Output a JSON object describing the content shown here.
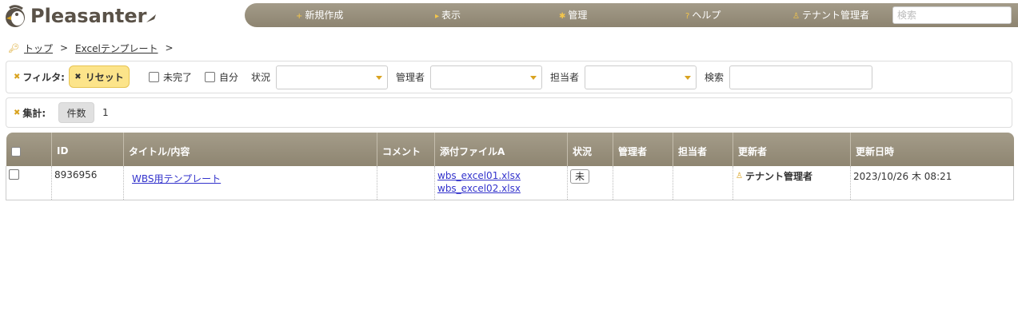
{
  "header": {
    "logo_text": "Pleasanter",
    "nav": [
      {
        "icon": "plus-icon",
        "glyph": "+",
        "label": "新規作成"
      },
      {
        "icon": "triangle-right-icon",
        "glyph": "▸",
        "label": "表示"
      },
      {
        "icon": "gear-icon",
        "glyph": "✱",
        "label": "管理"
      },
      {
        "icon": "question-icon",
        "glyph": "?",
        "label": "ヘルプ"
      },
      {
        "icon": "person-icon",
        "glyph": "♙",
        "label": "テナント管理者"
      }
    ],
    "search_placeholder": "検索"
  },
  "breadcrumb": {
    "items": [
      "トップ",
      "Excelテンプレート"
    ],
    "separator": ">"
  },
  "filter": {
    "label": "フィルタ:",
    "reset_label": "リセット",
    "checkboxes": [
      {
        "label": "未完了",
        "checked": false
      },
      {
        "label": "自分",
        "checked": false
      }
    ],
    "status_label": "状況",
    "manager_label": "管理者",
    "owner_label": "担当者",
    "search_label": "検索"
  },
  "aggregation": {
    "label": "集計:",
    "count_label": "件数",
    "count_value": "1"
  },
  "table": {
    "columns": [
      "ID",
      "タイトル/内容",
      "コメント",
      "添付ファイルA",
      "状況",
      "管理者",
      "担当者",
      "更新者",
      "更新日時"
    ],
    "rows": [
      {
        "id": "8936956",
        "title": "WBS用テンプレート",
        "comment": "",
        "attachments": [
          "wbs_excel01.xlsx",
          "wbs_excel02.xlsx"
        ],
        "status": "未",
        "manager": "",
        "owner": "",
        "updater": "テナント管理者",
        "updated_at": "2023/10/26 木 08:21"
      }
    ]
  },
  "colors": {
    "nav_bg": "#998f7c",
    "accent": "#d9a320",
    "reset_bg": "#fce48a",
    "link": "#3333cc"
  }
}
